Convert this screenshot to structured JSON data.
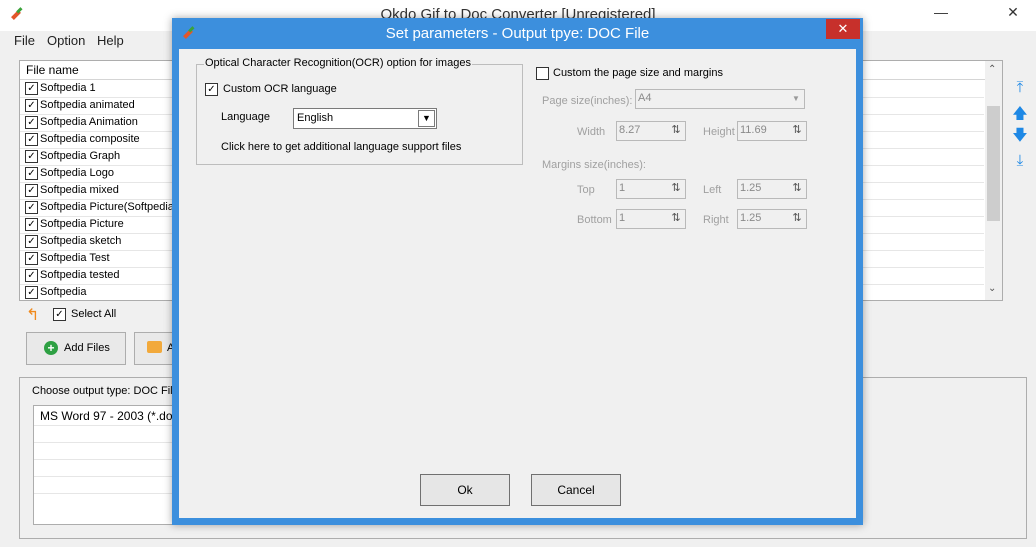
{
  "main": {
    "title": "Okdo Gif to Doc Converter [Unregistered]",
    "menu": [
      "File",
      "Option",
      "Help"
    ],
    "list_header": "File name",
    "files": [
      "Softpedia 1",
      "Softpedia animated",
      "Softpedia Animation",
      "Softpedia composite",
      "Softpedia Graph",
      "Softpedia Logo",
      "Softpedia mixed",
      "Softpedia Picture(Softpedia",
      "Softpedia Picture",
      "Softpedia sketch",
      "Softpedia Test",
      "Softpedia tested",
      "Softpedia"
    ],
    "select_all": "Select All",
    "add_files": "Add Files",
    "add_folder_partial": "A",
    "output_type_label": "Choose output type:  DOC Fil",
    "output_item": "MS Word 97 - 2003 (*.do"
  },
  "dialog": {
    "title": "Set parameters - Output tpye: DOC File",
    "ocr_group": "Optical Character Recognition(OCR) option for images",
    "custom_ocr": "Custom OCR language",
    "custom_ocr_checked": true,
    "language_label": "Language",
    "language_value": "English",
    "language_link": "Click here to get additional language support files",
    "custom_page": "Custom the page size and margins",
    "custom_page_checked": false,
    "page_size_label": "Page size(inches):",
    "page_size_value": "A4",
    "width_label": "Width",
    "width_value": "8.27",
    "height_label": "Height",
    "height_value": "11.69",
    "margins_label": "Margins size(inches):",
    "top_label": "Top",
    "top_value": "1",
    "left_label": "Left",
    "left_value": "1.25",
    "bottom_label": "Bottom",
    "bottom_value": "1",
    "right_label": "Right",
    "right_value": "1.25",
    "ok": "Ok",
    "cancel": "Cancel"
  },
  "colors": {
    "dialog_frame": "#3c8fdd",
    "close": "#c7302b",
    "accent_arrows": "#1e88e5"
  },
  "icons": [
    "app-icon",
    "up-folder-icon",
    "add-icon",
    "folder-icon",
    "move-top-icon",
    "move-up-icon",
    "move-down-icon",
    "move-bottom-icon"
  ]
}
